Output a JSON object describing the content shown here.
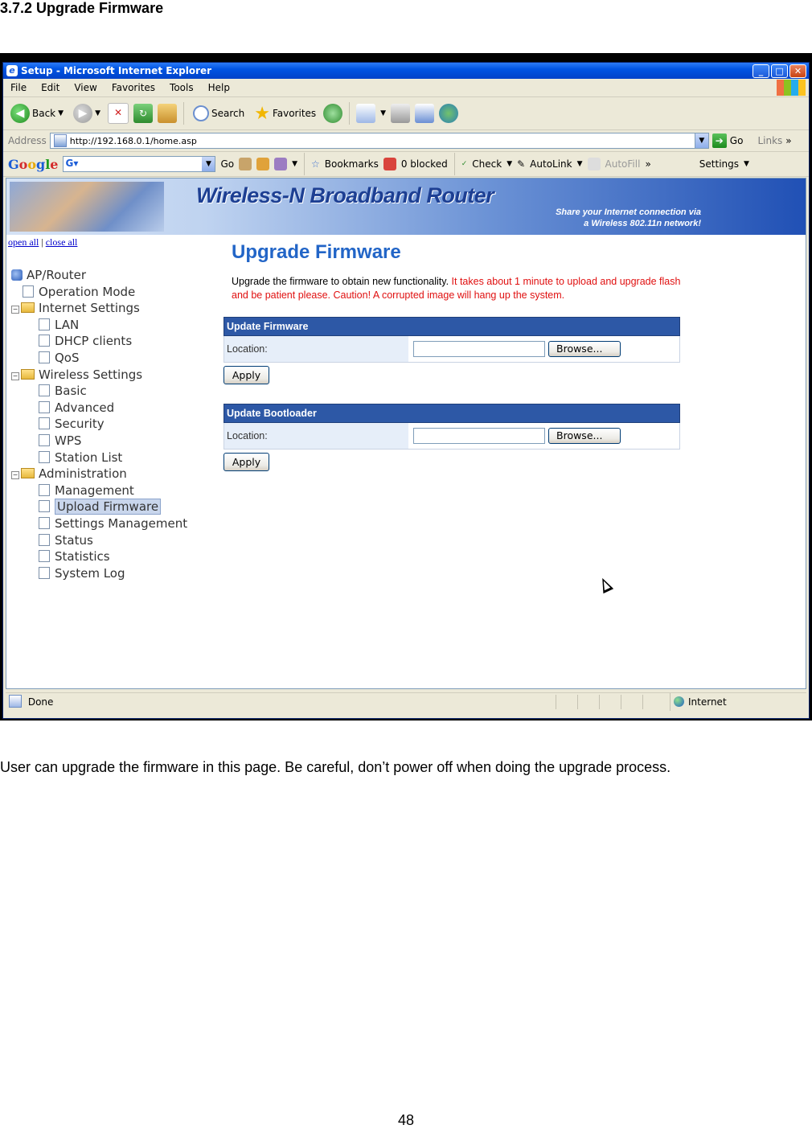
{
  "doc": {
    "heading": "3.7.2 Upgrade Firmware",
    "body": "User can upgrade the firmware in this page. Be careful, don’t power off when doing the upgrade process.",
    "page_number": "48"
  },
  "window": {
    "title": "Setup - Microsoft Internet Explorer",
    "menu": [
      "File",
      "Edit",
      "View",
      "Favorites",
      "Tools",
      "Help"
    ]
  },
  "toolbar": {
    "back": "Back",
    "search": "Search",
    "favorites": "Favorites"
  },
  "address": {
    "label": "Address",
    "url": "http://192.168.0.1/home.asp",
    "go": "Go",
    "links": "Links"
  },
  "googlebar": {
    "logo_parts": [
      "G",
      "o",
      "o",
      "g",
      "l",
      "e"
    ],
    "go": "Go",
    "bookmarks": "Bookmarks",
    "blocked": "0 blocked",
    "check": "Check",
    "autolink": "AutoLink",
    "autofill": "AutoFill",
    "settings": "Settings"
  },
  "banner": {
    "title": "Wireless-N Broadband Router",
    "tagline_1": "Share your Internet connection via",
    "tagline_2": "a Wireless 802.11n network!"
  },
  "tree": {
    "open_all": "open all",
    "divider": "|",
    "close_all": "close all",
    "root": "AP/Router",
    "items": {
      "operation_mode": "Operation Mode",
      "internet_settings": "Internet Settings",
      "lan": "LAN",
      "dhcp": "DHCP clients",
      "qos": "QoS",
      "wireless_settings": "Wireless Settings",
      "basic": "Basic",
      "advanced": "Advanced",
      "security": "Security",
      "wps": "WPS",
      "station_list": "Station List",
      "administration": "Administration",
      "management": "Management",
      "upload_firmware": "Upload Firmware",
      "settings_management": "Settings Management",
      "status": "Status",
      "statistics": "Statistics",
      "system_log": "System Log"
    }
  },
  "main": {
    "title": "Upgrade Firmware",
    "desc_normal": "Upgrade the firmware to obtain new functionality. ",
    "desc_warning": "It takes about 1 minute to upload and upgrade flash and be patient please. Caution! A corrupted image will hang up the system.",
    "firmware": {
      "header": "Update Firmware",
      "location_label": "Location:",
      "browse": "Browse...",
      "apply": "Apply",
      "value": ""
    },
    "bootloader": {
      "header": "Update Bootloader",
      "location_label": "Location:",
      "browse": "Browse...",
      "apply": "Apply",
      "value": ""
    }
  },
  "status": {
    "text": "Done",
    "zone": "Internet"
  }
}
